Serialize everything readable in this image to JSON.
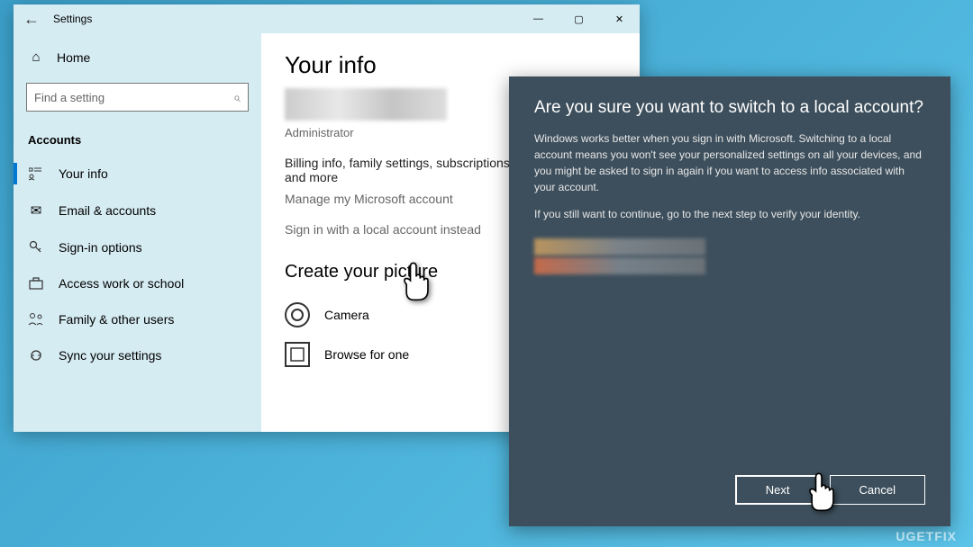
{
  "window": {
    "title": "Settings",
    "controls": {
      "minimize": "—",
      "maximize": "▢",
      "close": "✕"
    }
  },
  "sidebar": {
    "home_label": "Home",
    "search_placeholder": "Find a setting",
    "section_label": "Accounts",
    "items": [
      {
        "label": "Your info",
        "icon": "person"
      },
      {
        "label": "Email & accounts",
        "icon": "mail"
      },
      {
        "label": "Sign-in options",
        "icon": "key"
      },
      {
        "label": "Access work or school",
        "icon": "briefcase"
      },
      {
        "label": "Family & other users",
        "icon": "family"
      },
      {
        "label": "Sync your settings",
        "icon": "sync"
      }
    ]
  },
  "content": {
    "page_title": "Your info",
    "role": "Administrator",
    "billing_text": "Billing info, family settings, subscriptions, security settings and more",
    "manage_link": "Manage my Microsoft account",
    "local_link": "Sign in with a local account instead",
    "picture_heading": "Create your picture",
    "camera_label": "Camera",
    "browse_label": "Browse for one"
  },
  "dialog": {
    "title": "Are you sure you want to switch to a local account?",
    "body1": "Windows works better when you sign in with Microsoft. Switching to a local account means you won't see your personalized settings on all your devices, and you might be asked to sign in again if you want to access info associated with your account.",
    "body2": "If you still want to continue, go to the next step to verify your identity.",
    "next_label": "Next",
    "cancel_label": "Cancel"
  },
  "watermark": "UGETFIX"
}
